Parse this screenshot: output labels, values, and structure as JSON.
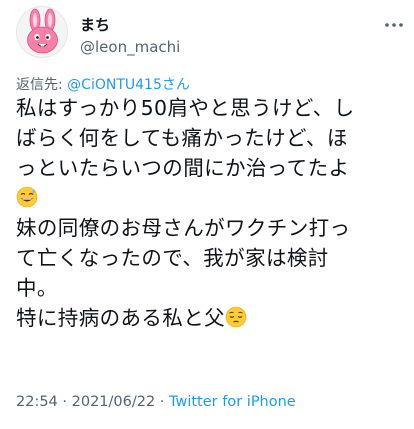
{
  "user": {
    "display_name": "まち",
    "handle": "@leon_machi",
    "avatar_icon": "pink-bunny-avatar-icon"
  },
  "reply": {
    "prefix": "返信先: ",
    "mention": "@CiONTU415さん"
  },
  "tweet": {
    "lines": [
      "私はすっかり50肩やと思うけど、し",
      "ばらく何をしても痛かったけど、ほ",
      "っといたらいつの間にか治ってたよ",
      "",
      "妹の同僚のお母さんがワクチン打っ",
      "て亡くなったので、我が家は検討",
      "中。",
      "特に持病のある私と父"
    ],
    "emoji_1": "grinning-sweat-emoji",
    "emoji_2": "pensive-face-emoji"
  },
  "meta": {
    "time": "22:54",
    "separator_1": " · ",
    "date": "2021/06/22",
    "separator_2": " · ",
    "source": "Twitter for iPhone"
  },
  "colors": {
    "text": "#0f1419",
    "secondary": "#536471",
    "link": "#1d9bf0",
    "avatar_pink": "#f57fa9"
  }
}
